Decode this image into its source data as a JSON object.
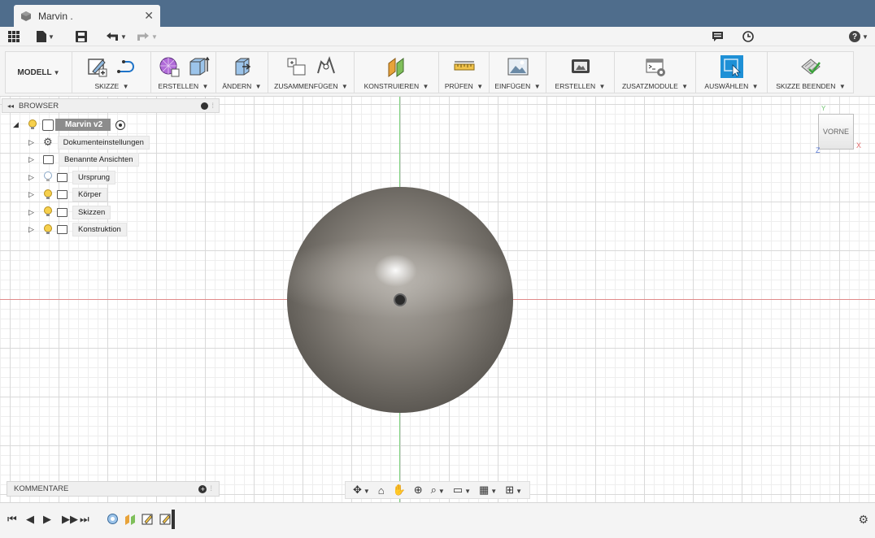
{
  "tab": {
    "title": "Marvin .",
    "close": "✕"
  },
  "quickbar": {
    "help": "?"
  },
  "ribbon": {
    "workspace": "MODELL",
    "groups": [
      "SKIZZE",
      "ERSTELLEN",
      "ÄNDERN",
      "ZUSAMMENFÜGEN",
      "KONSTRUIEREN",
      "PRÜFEN",
      "EINFÜGEN",
      "ERSTELLEN",
      "ZUSATZMODULE",
      "AUSWÄHLEN",
      "SKIZZE BEENDEN"
    ]
  },
  "browser": {
    "title": "BROWSER",
    "root": "Marvin v2",
    "items": [
      "Dokumenteinstellungen",
      "Benannte Ansichten",
      "Ursprung",
      "Körper",
      "Skizzen",
      "Konstruktion"
    ]
  },
  "viewcube": {
    "face": "VORNE",
    "x": "X",
    "y": "Y",
    "z": "Z"
  },
  "comments": {
    "title": "KOMMENTARE"
  },
  "colors": {
    "accent": "#1e90d6",
    "titlebar": "#4f6d8c",
    "axis_x": "#e08a8a",
    "axis_y": "#7ed07e"
  }
}
